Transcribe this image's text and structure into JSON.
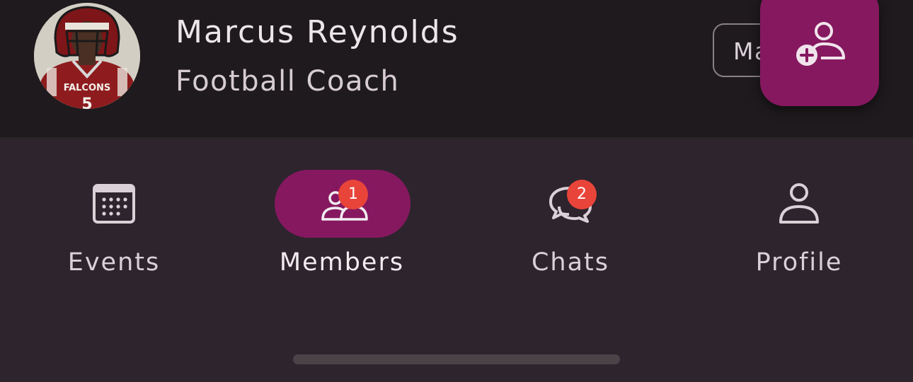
{
  "member": {
    "name": "Marcus Reynolds",
    "role": "Football Coach",
    "avatar_icon": "falcons-player-avatar",
    "jersey_text": "FALCONS",
    "jersey_number": "5",
    "manage_button_label": "Ma"
  },
  "fab": {
    "icon": "add-person-icon"
  },
  "nav": {
    "items": [
      {
        "label": "Events",
        "icon": "calendar-icon",
        "active": false,
        "badge": ""
      },
      {
        "label": "Members",
        "icon": "members-icon",
        "active": true,
        "badge": "1"
      },
      {
        "label": "Chats",
        "icon": "chat-icon",
        "active": false,
        "badge": "2"
      },
      {
        "label": "Profile",
        "icon": "person-icon",
        "active": false,
        "badge": ""
      }
    ]
  },
  "colors": {
    "background": "#1e1a1d",
    "nav_background": "#2e242d",
    "accent": "#861860",
    "badge": "#e9443a",
    "text": "#ece6ea"
  }
}
